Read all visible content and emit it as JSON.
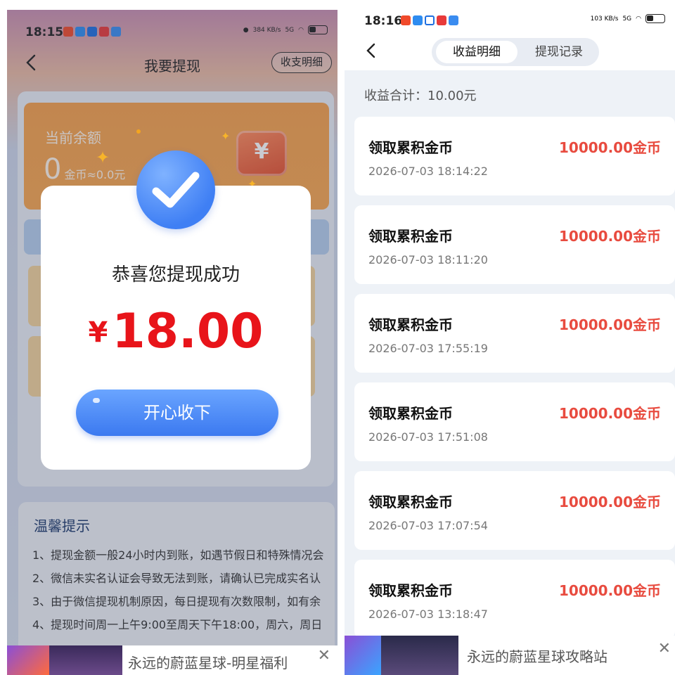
{
  "left": {
    "status": {
      "time": "18:15",
      "net_speed": "384 KB/s",
      "network": "5G"
    },
    "nav": {
      "title": "我要提现",
      "ledger_button": "收支明细"
    },
    "balance": {
      "label": "当前余额",
      "value": "0",
      "approx": "金币≈0.0元"
    },
    "modal": {
      "title": "恭喜您提现成功",
      "currency": "¥",
      "amount": "18.00",
      "button": "开心收下"
    },
    "tips": {
      "title": "温馨提示",
      "items": [
        "1、提现金额一般24小时内到账，如遇节假日和特殊情况会",
        "2、微信未实名认证会导致无法到账，请确认已完成实名认",
        "3、由于微信提现机制原因，每日提现有次数限制，如有余",
        "4、提现时间周一上午9:00至周天下午18:00，周六，周日"
      ]
    },
    "ad": {
      "text": "永远的蔚蓝星球-明星福利"
    },
    "colors": {
      "accent_blue": "#3f7ff4",
      "amount_red": "#e8141a",
      "balance_orange": "#f6a04c"
    }
  },
  "right": {
    "status": {
      "time": "18:16",
      "net_speed": "103 KB/s",
      "network": "5G"
    },
    "tabs": [
      {
        "label": "收益明细",
        "active": true
      },
      {
        "label": "提现记录",
        "active": false
      }
    ],
    "total": "收益合计：10.00元",
    "records": [
      {
        "title": "领取累积金币",
        "time": "2026-07-03 18:14:22",
        "amount": "10000.00金币"
      },
      {
        "title": "领取累积金币",
        "time": "2026-07-03 18:11:20",
        "amount": "10000.00金币"
      },
      {
        "title": "领取累积金币",
        "time": "2026-07-03 17:55:19",
        "amount": "10000.00金币"
      },
      {
        "title": "领取累积金币",
        "time": "2026-07-03 17:51:08",
        "amount": "10000.00金币"
      },
      {
        "title": "领取累积金币",
        "time": "2026-07-03 17:07:54",
        "amount": "10000.00金币"
      },
      {
        "title": "领取累积金币",
        "time": "2026-07-03 13:18:47",
        "amount": "10000.00金币"
      }
    ],
    "ad": {
      "text": "永远的蔚蓝星球攻略站"
    },
    "colors": {
      "amount_red": "#e84b3f"
    }
  }
}
